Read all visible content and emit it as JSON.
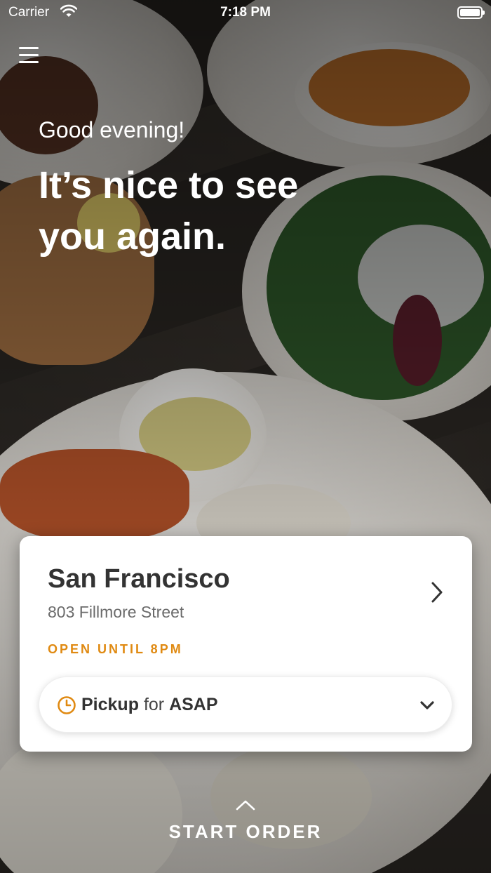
{
  "status_bar": {
    "carrier": "Carrier",
    "time": "7:18 PM"
  },
  "hero": {
    "greeting": "Good evening!",
    "headline": "It’s nice to see you again."
  },
  "location_card": {
    "name": "San Francisco",
    "address": "803 Fillmore Street",
    "hours_status": "OPEN UNTIL 8PM",
    "order_mode": {
      "mode": "Pickup",
      "connector": "for",
      "time": "ASAP"
    }
  },
  "footer": {
    "start_order_label": "START ORDER"
  },
  "colors": {
    "accent": "#e08a12",
    "card_background": "#ffffff",
    "title_text": "#333333"
  },
  "icons": [
    "wifi-icon",
    "battery-icon",
    "menu-icon",
    "chevron-right-icon",
    "clock-icon",
    "chevron-down-icon",
    "chevron-up-icon"
  ]
}
